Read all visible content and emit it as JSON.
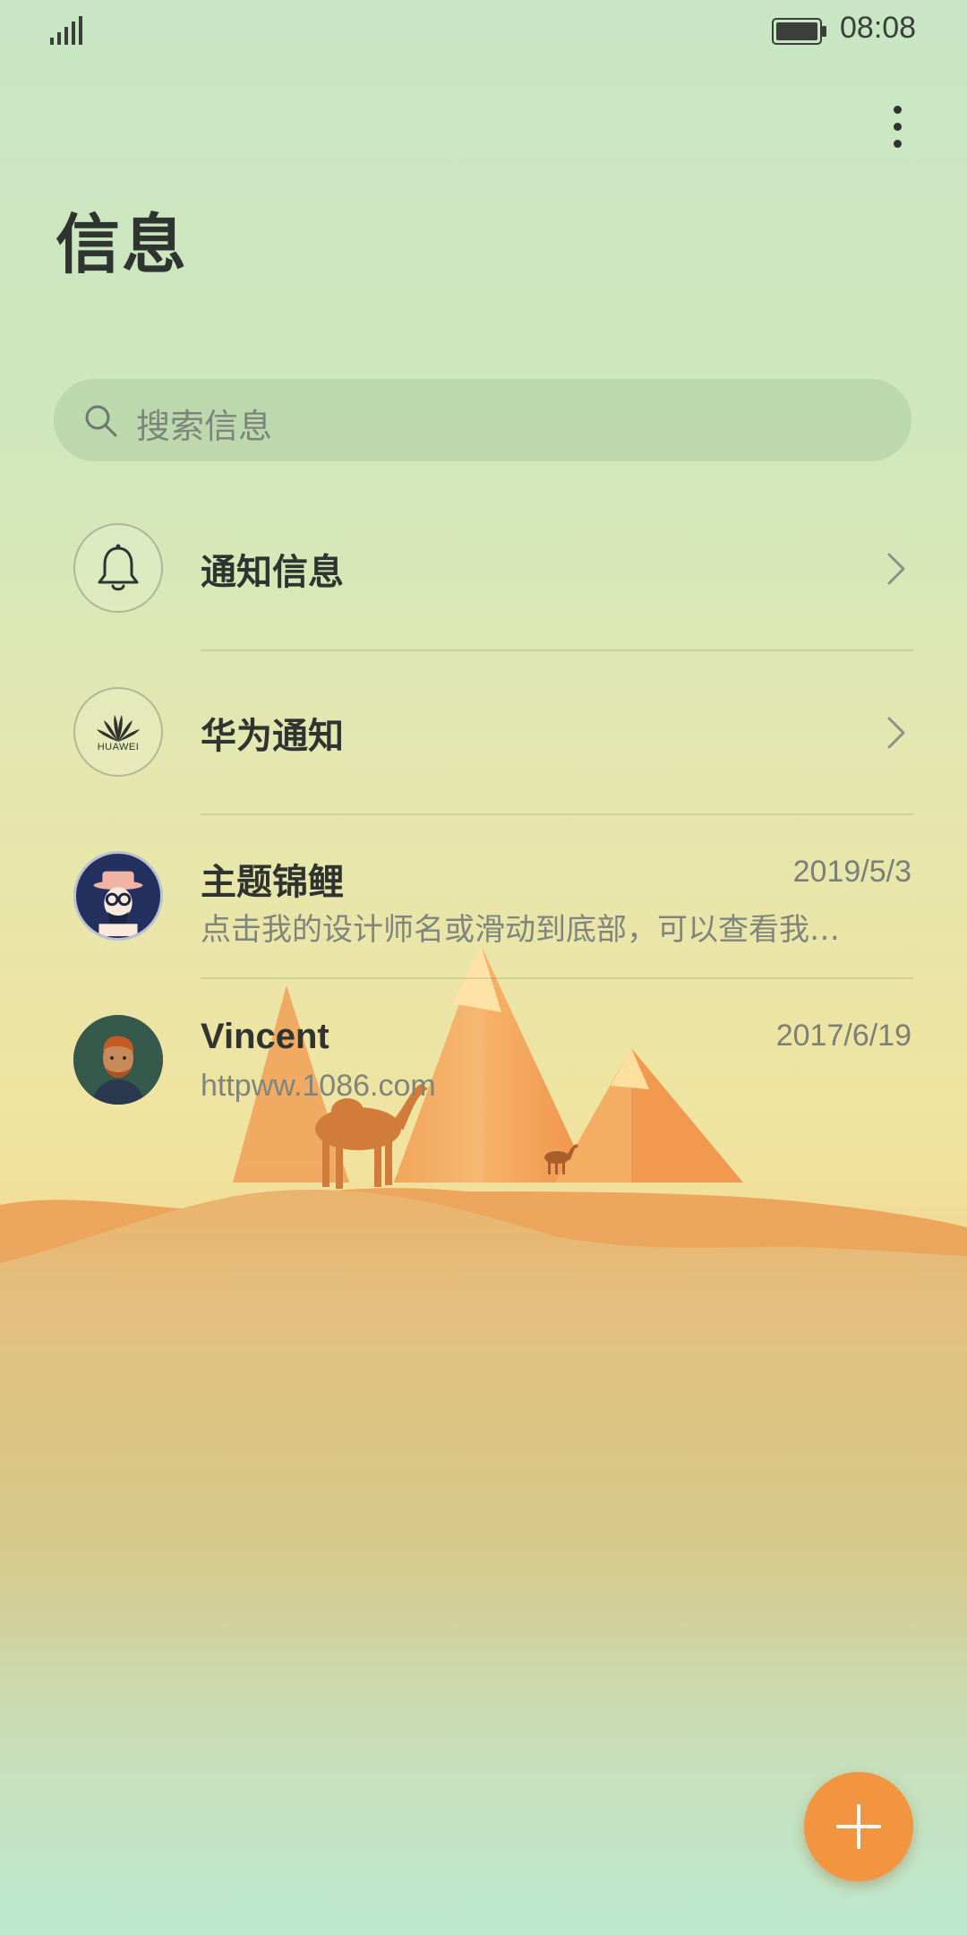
{
  "status_bar": {
    "time": "08:08",
    "signal_icon": "signal-icon",
    "battery_icon": "battery-icon"
  },
  "header": {
    "title": "信息",
    "more_icon": "more-vertical-icon"
  },
  "search": {
    "placeholder": "搜索信息",
    "icon": "search-icon"
  },
  "conversations": [
    {
      "title": "通知信息",
      "icon": "bell-icon",
      "chevron": "chevron-right-icon"
    },
    {
      "title": "华为通知",
      "icon": "huawei-logo",
      "logo_text": "HUAWEI",
      "chevron": "chevron-right-icon"
    },
    {
      "title": "主题锦鲤",
      "subtitle": "点击我的设计师名或滑动到底部，可以查看我…",
      "date": "2019/5/3",
      "avatar": "hat-glasses-avatar"
    },
    {
      "title": "Vincent",
      "subtitle": "httpww.1086.com",
      "date": "2017/6/19",
      "avatar": "portrait-avatar"
    }
  ],
  "fab": {
    "icon": "plus-icon"
  },
  "colors": {
    "fab": "#f39540",
    "title_text": "#2f3430",
    "secondary_text": "#7f857c"
  }
}
